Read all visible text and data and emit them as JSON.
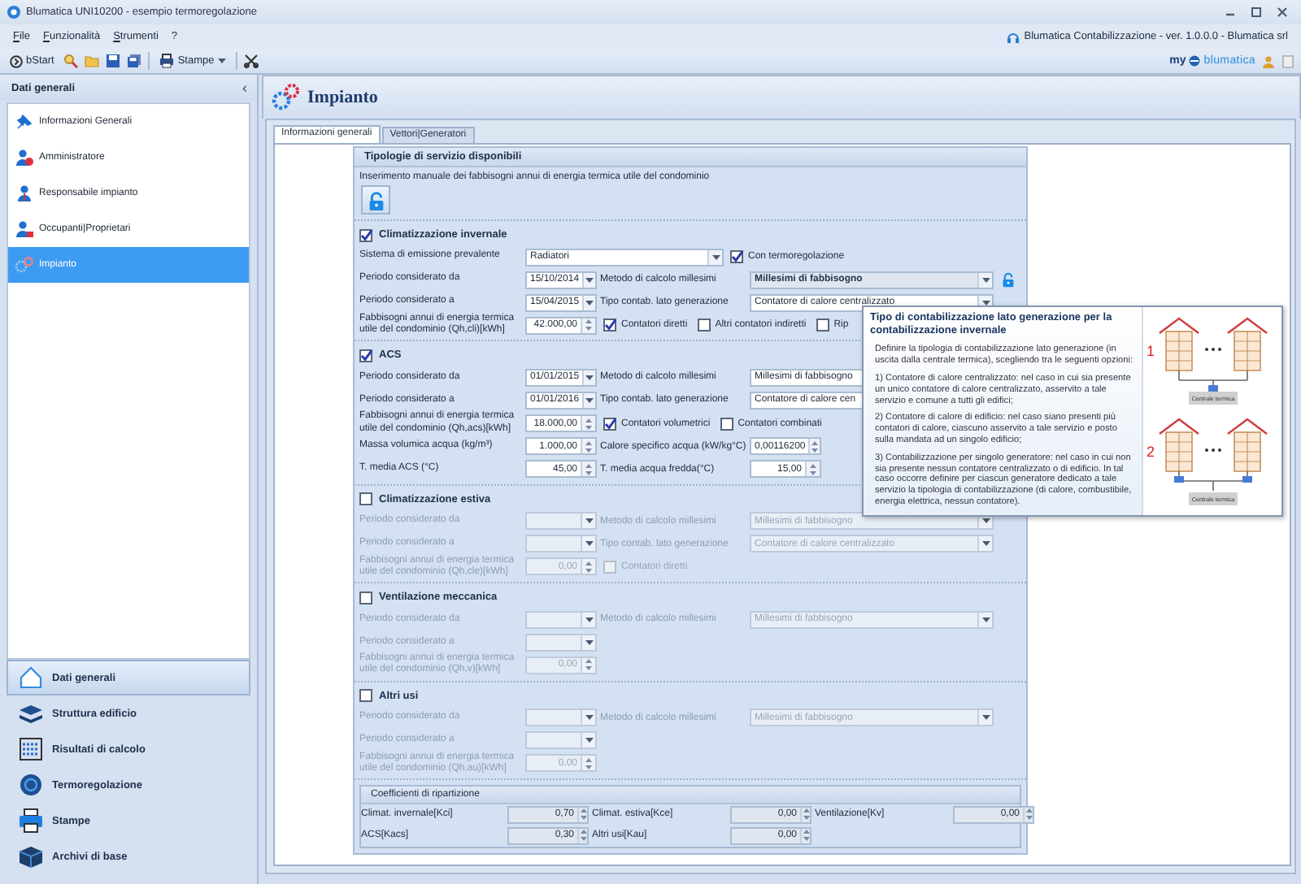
{
  "window": {
    "title": "Blumatica UNI10200 - esempio termoregolazione"
  },
  "menu": [
    {
      "label": "File",
      "mnemonic": true
    },
    {
      "label": "Funzionalità",
      "mnemonic": true
    },
    {
      "label": "Strumenti",
      "mnemonic": true
    },
    {
      "label": "?",
      "mnemonic": false
    }
  ],
  "app_info": "Blumatica Contabilizzazione - ver. 1.0.0.0 - Blumatica srl",
  "toolbar": {
    "start": "bStart",
    "print": "Stampe"
  },
  "brand": {
    "prefix": "my",
    "name": "blumatica"
  },
  "sidebar": {
    "title": "Dati generali",
    "collapse": "‹",
    "items": [
      {
        "label": "Informazioni Generali",
        "selected": false
      },
      {
        "label": "Amministratore",
        "selected": false
      },
      {
        "label": "Responsabile impianto",
        "selected": false
      },
      {
        "label": "Occupanti|Proprietari",
        "selected": false
      },
      {
        "label": "Impianto",
        "selected": true
      }
    ]
  },
  "modules": [
    {
      "label": "Dati generali",
      "selected": true
    },
    {
      "label": "Struttura edificio",
      "selected": false
    },
    {
      "label": "Risultati di calcolo",
      "selected": false
    },
    {
      "label": "Termoregolazione",
      "selected": false
    },
    {
      "label": "Stampe",
      "selected": false
    },
    {
      "label": "Archivi di base",
      "selected": false
    }
  ],
  "page": {
    "title": "Impianto",
    "tabs": [
      {
        "label": "Informazioni generali",
        "selected": true
      },
      {
        "label": "Vettori|Generatori",
        "selected": false
      }
    ]
  },
  "form": {
    "title": "Tipologie di servizio disponibili",
    "intro": "Inserimento manuale dei fabbisogni annui di energia termica utile del condominio",
    "sections": [
      {
        "title": "Climatizzazione invernale",
        "checked": true,
        "rows": [
          {
            "label": "Sistema di emissione prevalente",
            "field": {
              "kind": "combo",
              "value": "Radiatori"
            },
            "checks": [
              {
                "label": "Con termoregolazione",
                "checked": true
              }
            ]
          },
          {
            "label": "Periodo considerato da",
            "field": {
              "kind": "date",
              "value": "15/10/2014"
            },
            "label_2": "Metodo di calcolo millesimi",
            "field_2": {
              "kind": "combo",
              "value": "Millesimi di fabbisogno",
              "locked": true
            }
          },
          {
            "label": "Periodo considerato a",
            "field": {
              "kind": "date",
              "value": "15/04/2015"
            },
            "label_2": "Tipo contab. lato generazione",
            "field_2": {
              "kind": "combo",
              "value": "Contatore di calore centralizzato",
              "locked": false
            }
          },
          {
            "label": "Fabbisogni annui di energia termica utile del condominio (Qh,cli)[kWh]",
            "field": {
              "kind": "number",
              "value": "42.000,00"
            },
            "checks": [
              {
                "label": "Contatori diretti",
                "checked": true
              },
              {
                "label": "Altri contatori indiretti",
                "checked": false
              },
              {
                "label": "Rip",
                "checked": false
              }
            ]
          }
        ]
      },
      {
        "title": "ACS",
        "checked": true,
        "rows": [
          {
            "label": "Periodo considerato da",
            "field": {
              "kind": "date",
              "value": "01/01/2015"
            },
            "label_2": "Metodo di calcolo millesimi",
            "field_2": {
              "kind": "combo",
              "value": "Millesimi di fabbisogno",
              "locked": false
            }
          },
          {
            "label": "Periodo considerato a",
            "field": {
              "kind": "date",
              "value": "01/01/2016"
            },
            "label_2": "Tipo contab. lato generazione",
            "field_2": {
              "kind": "combo",
              "value": "Contatore di calore cen",
              "locked": false
            }
          },
          {
            "label": "Fabbisogni annui di energia termica utile del condominio (Qh,acs)[kWh]",
            "field": {
              "kind": "number",
              "value": "18.000,00"
            },
            "checks": [
              {
                "label": "Contatori volumetrici",
                "checked": true
              },
              {
                "label": "Contatori combinati",
                "checked": false
              }
            ]
          },
          {
            "label": "Massa volumica acqua (kg/m³)",
            "field": {
              "kind": "number",
              "value": "1.000,00"
            },
            "label_2": "Calore specifico acqua (kW/kg°C)",
            "field_2": {
              "kind": "number",
              "value": "0,00116200"
            }
          },
          {
            "label": "T. media ACS (°C)",
            "field": {
              "kind": "number",
              "value": "45,00"
            },
            "label_2": "T. media acqua fredda(°C)",
            "field_2": {
              "kind": "number",
              "value": "15,00"
            }
          }
        ]
      },
      {
        "title": "Climatizzazione estiva",
        "checked": false,
        "rows": [
          {
            "label": "Periodo considerato da",
            "field": {
              "kind": "date"
            },
            "label_2": "Metodo di calcolo millesimi",
            "field_2": {
              "kind": "combo",
              "value": "Millesimi di fabbisogno",
              "locked": false
            }
          },
          {
            "label": "Periodo considerato a",
            "field": {
              "kind": "date"
            },
            "label_2": "Tipo contab. lato generazione",
            "field_2": {
              "kind": "combo",
              "value": "Contatore di calore centralizzato",
              "locked": false
            }
          },
          {
            "label": "Fabbisogni annui di energia termica utile del condominio (Qh,cle)[kWh]",
            "field": {
              "kind": "number",
              "value": "0,00"
            },
            "checks": [
              {
                "label": "Contatori diretti",
                "checked": false
              }
            ]
          }
        ]
      },
      {
        "title": "Ventilazione meccanica",
        "checked": false,
        "rows": [
          {
            "label": "Periodo considerato da",
            "field": {
              "kind": "date"
            },
            "label_2": "Metodo di calcolo millesimi",
            "field_2": {
              "kind": "combo",
              "value": "Millesimi di fabbisogno",
              "locked": false
            }
          },
          {
            "label": "Periodo considerato a",
            "field": {
              "kind": "date"
            }
          },
          {
            "label": "Fabbisogni annui di energia termica utile del condominio (Qh,v)[kWh]",
            "field": {
              "kind": "number",
              "value": "0,00"
            }
          }
        ]
      },
      {
        "title": "Altri usi",
        "checked": false,
        "rows": [
          {
            "label": "Periodo considerato da",
            "field": {
              "kind": "date"
            },
            "label_2": "Metodo di calcolo millesimi",
            "field_2": {
              "kind": "combo",
              "value": "Millesimi di fabbisogno",
              "locked": false
            }
          },
          {
            "label": "Periodo considerato a",
            "field": {
              "kind": "date"
            }
          },
          {
            "label": "Fabbisogni annui di energia termica utile del condominio (Qh,au)[kWh]",
            "field": {
              "kind": "number",
              "value": "0,00"
            }
          }
        ]
      }
    ]
  },
  "coefficients": {
    "title": "Coefficienti di ripartizione",
    "rows": [
      {
        "items": [
          {
            "label": "Climat. invernale[Kci]",
            "value": "0,70"
          },
          {
            "label": "Climat. estiva[Kce]",
            "value": "0,00"
          },
          {
            "label": "Ventilazione[Kv]",
            "value": "0,00"
          }
        ]
      },
      {
        "items": [
          {
            "label": "ACS[Kacs]",
            "value": "0,30"
          },
          {
            "label": "Altri usi[Kau]",
            "value": "0,00"
          }
        ]
      }
    ]
  },
  "tooltip": {
    "title": "Tipo di contabilizzazione lato generazione per la contabilizzazione invernale",
    "paragraphs": [
      "Definire la tipologia di contabilizzazione lato generazione (in uscita dalla centrale termica), scegliendo tra le seguenti opzioni:",
      "1) Contatore di calore centralizzato: nel caso in cui sia presente un unico contatore di calore centralizzato, asservito a tale servizio e comune a tutti gli edifici;",
      "2) Contatore di calore di edificio: nel caso siano presenti più contatori di calore, ciascuno asservito a tale servizio e posto sulla mandata ad un singolo edificio;",
      "3) Contabilizzazione per singolo generatore: nel caso in cui non sia presente nessun contatore centralizzato o di edificio. In tal caso occorre definire per ciascun generatore dedicato a tale servizio la tipologia di contabilizzazione (di calore, combustibile, energia elettrica, nessun contatore)."
    ],
    "diagrams": [
      {
        "number": "1",
        "caption": "Centrale termica"
      },
      {
        "number": "2",
        "caption": "Centrale termica"
      }
    ]
  }
}
